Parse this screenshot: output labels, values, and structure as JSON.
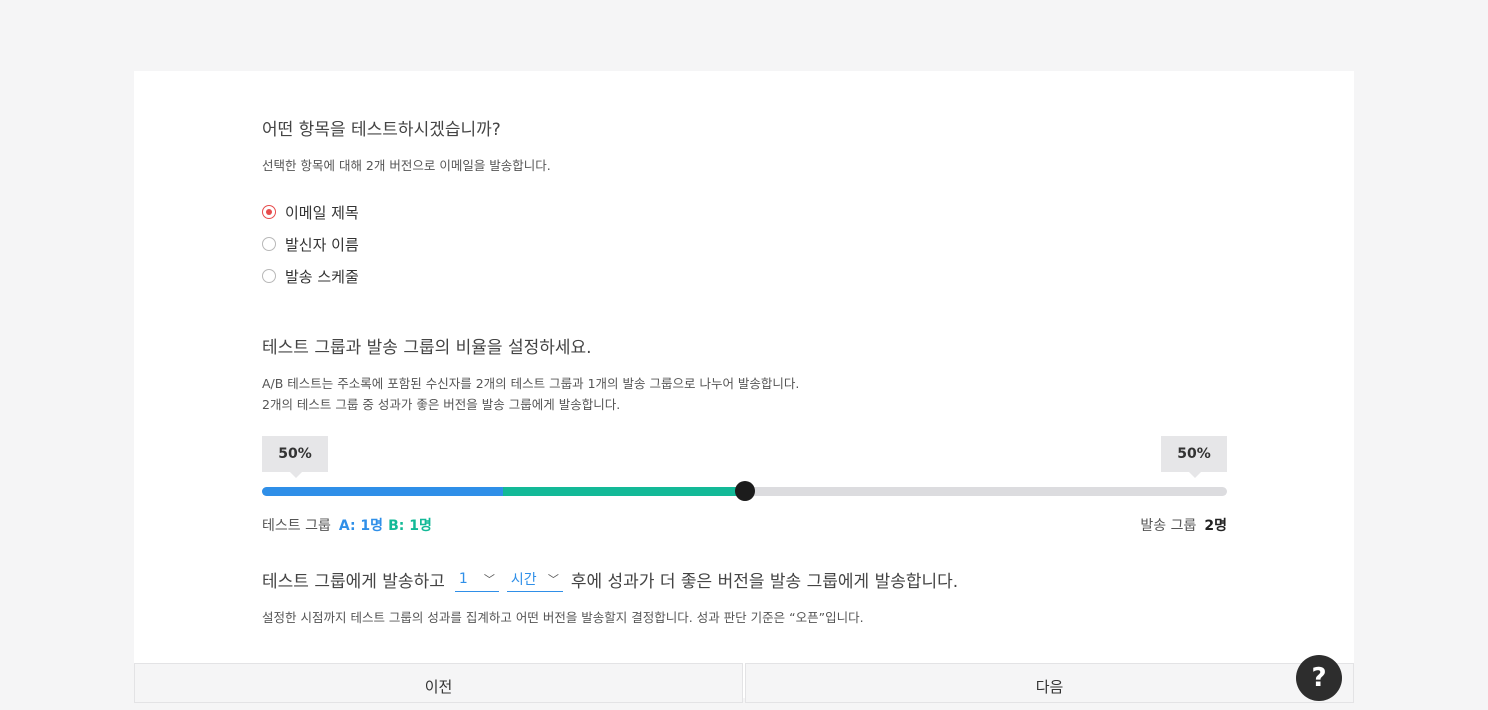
{
  "section1": {
    "title": "어떤 항목을 테스트하시겠습니까?",
    "desc": "선택한 항목에 대해 2개 버전으로 이메일을 발송합니다.",
    "options": [
      {
        "label": "이메일 제목",
        "checked": true
      },
      {
        "label": "발신자 이름",
        "checked": false
      },
      {
        "label": "발송 스케줄",
        "checked": false
      }
    ]
  },
  "section2": {
    "title": "테스트 그룹과 발송 그룹의 비율을 설정하세요.",
    "desc_line1": "A/B 테스트는 주소록에 포함된 수신자를 2개의 테스트 그룹과 1개의 발송 그룹으로 나누어 발송합니다.",
    "desc_line2": "2개의 테스트 그룹 중 성과가 좋은 버전을 발송 그룹에게 발송합니다."
  },
  "ratio": {
    "test_percent_label": "50%",
    "send_percent_label": "50%",
    "test_fraction": 0.5,
    "group_a_fraction": 0.25
  },
  "groups": {
    "test_label": "테스트 그룹",
    "test_a": "A: 1명",
    "test_b": "B: 1명",
    "send_label": "발송 그룹",
    "send_count": "2명"
  },
  "schedule": {
    "prefix": "테스트 그룹에게 발송하고",
    "amount": "1",
    "unit": "시간",
    "suffix": "후에 성과가 더 좋은 버전을 발송 그룹에게 발송합니다.",
    "note": "설정한 시점까지 테스트 그룹의 성과를 집계하고 어떤 버전을 발송할지 결정합니다. 성과 판단 기준은 “오픈”입니다."
  },
  "buttons": {
    "prev": "이전",
    "next": "다음"
  },
  "help_label": "?",
  "colors": {
    "group_a": "#2f8fe8",
    "group_b": "#13b997",
    "radio_checked": "#e74c4c"
  }
}
